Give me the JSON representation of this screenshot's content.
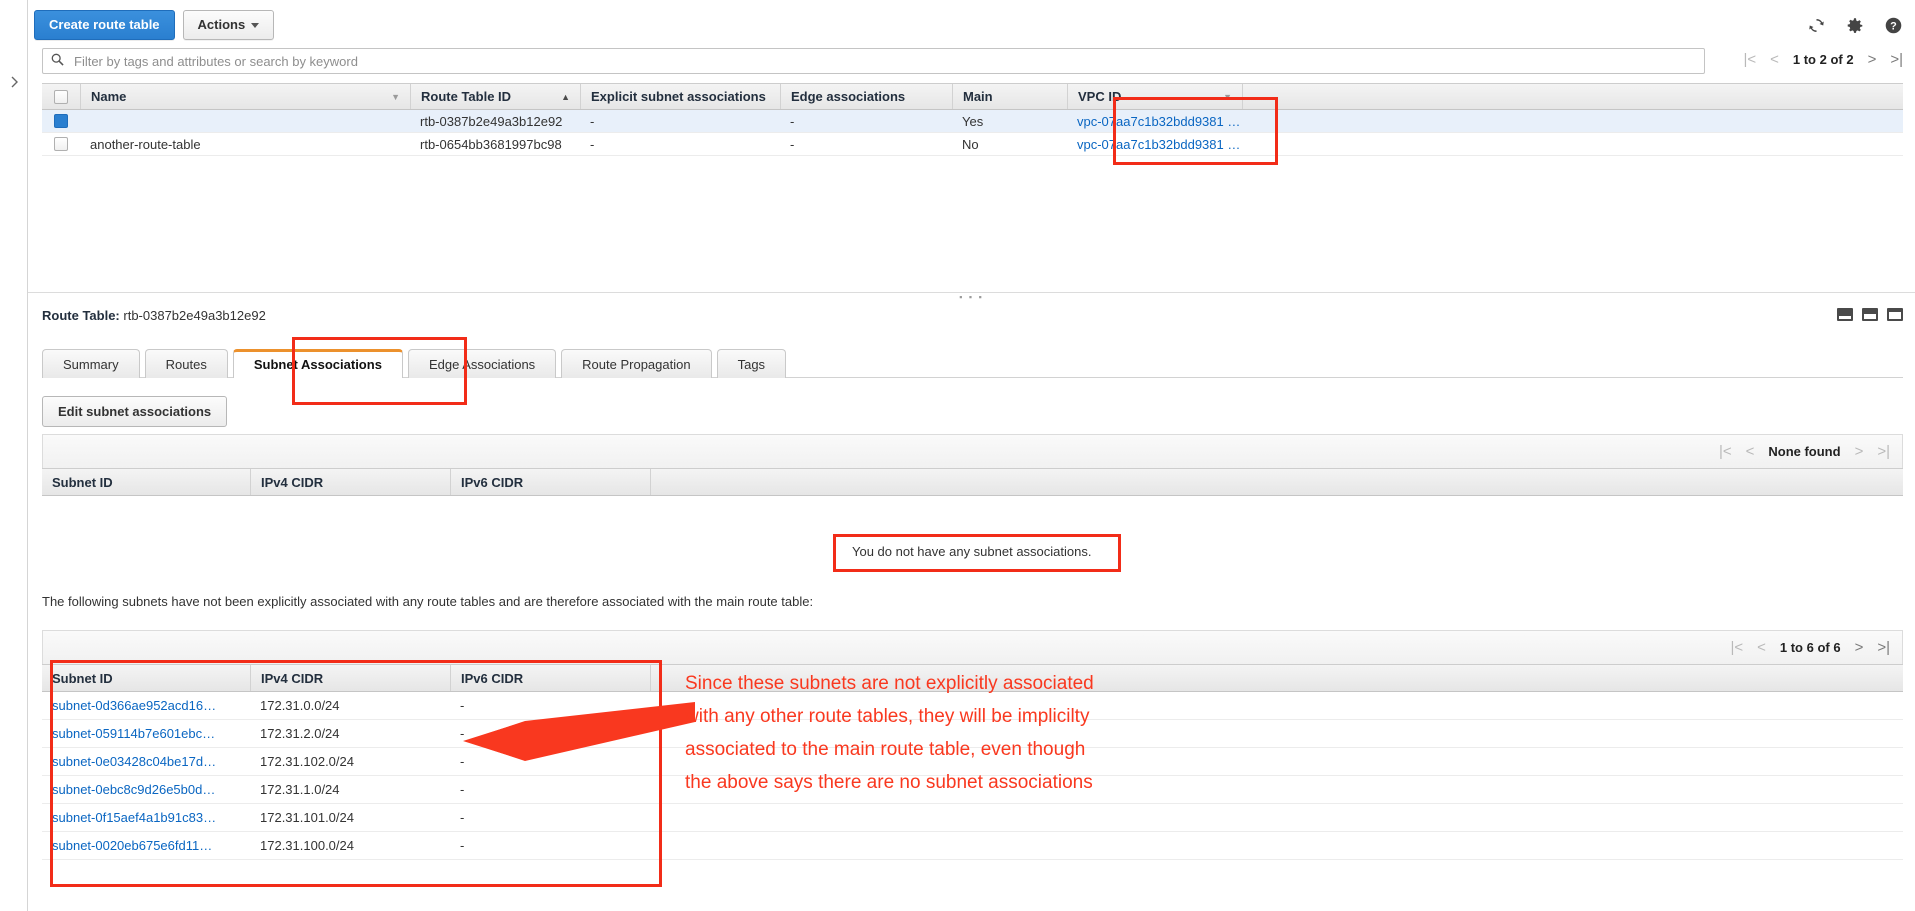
{
  "toolbar": {
    "create_label": "Create route table",
    "actions_label": "Actions",
    "refresh_icon": "refresh-icon",
    "settings_icon": "gear-icon",
    "help_icon": "help-icon"
  },
  "search": {
    "placeholder": "Filter by tags and attributes or search by keyword",
    "icon": "search-icon"
  },
  "top_pager": {
    "label": "1 to 2 of 2",
    "first": "|<",
    "prev": "<",
    "next": ">",
    "last": ">|"
  },
  "route_table_grid": {
    "columns": [
      "Name",
      "Route Table ID",
      "Explicit subnet associations",
      "Edge associations",
      "Main",
      "VPC ID"
    ],
    "rows": [
      {
        "selected": true,
        "name": "",
        "route_table_id": "rtb-0387b2e49a3b12e92",
        "explicit_subnet_associations": "-",
        "edge_associations": "-",
        "main": "Yes",
        "vpc_id": "vpc-07aa7c1b32bdd9381 …"
      },
      {
        "selected": false,
        "name": "another-route-table",
        "route_table_id": "rtb-0654bb3681997bc98",
        "explicit_subnet_associations": "-",
        "edge_associations": "-",
        "main": "No",
        "vpc_id": "vpc-07aa7c1b32bdd9381 …"
      }
    ]
  },
  "detail": {
    "title_label": "Route Table:",
    "title_value": "rtb-0387b2e49a3b12e92",
    "tabs": [
      {
        "label": "Summary",
        "active": false
      },
      {
        "label": "Routes",
        "active": false
      },
      {
        "label": "Subnet Associations",
        "active": true
      },
      {
        "label": "Edge Associations",
        "active": false
      },
      {
        "label": "Route Propagation",
        "active": false
      },
      {
        "label": "Tags",
        "active": false
      }
    ],
    "edit_button": "Edit subnet associations"
  },
  "associations_table": {
    "pager": {
      "label": "None found",
      "first": "|<",
      "prev": "<",
      "next": ">",
      "last": ">|"
    },
    "columns": [
      "Subnet ID",
      "IPv4 CIDR",
      "IPv6 CIDR"
    ],
    "rows": [],
    "empty_message": "You do not have any subnet associations."
  },
  "implicit_section": {
    "note": "The following subnets have not been explicitly associated with any route tables and are therefore associated with the main route table:",
    "pager": {
      "label": "1 to 6 of 6",
      "first": "|<",
      "prev": "<",
      "next": ">",
      "last": ">|"
    },
    "columns": [
      "Subnet ID",
      "IPv4 CIDR",
      "IPv6 CIDR"
    ],
    "rows": [
      {
        "subnet_id": "subnet-0d366ae952acd16…",
        "ipv4": "172.31.0.0/24",
        "ipv6": "-"
      },
      {
        "subnet_id": "subnet-059114b7e601ebc…",
        "ipv4": "172.31.2.0/24",
        "ipv6": "-"
      },
      {
        "subnet_id": "subnet-0e03428c04be17d…",
        "ipv4": "172.31.102.0/24",
        "ipv6": "-"
      },
      {
        "subnet_id": "subnet-0ebc8c9d26e5b0d…",
        "ipv4": "172.31.1.0/24",
        "ipv6": "-"
      },
      {
        "subnet_id": "subnet-0f15aef4a1b91c83…",
        "ipv4": "172.31.101.0/24",
        "ipv6": "-"
      },
      {
        "subnet_id": "subnet-0020eb675e6fd11…",
        "ipv4": "172.31.100.0/24",
        "ipv6": "-"
      }
    ]
  },
  "annotation": {
    "color": "#f9381f",
    "lines": [
      "Since these subnets are not explicitly associated",
      "with any other route tables, they will be implicilty",
      "associated to the main route table, even though",
      "the above says there are no subnet associations"
    ]
  },
  "view_icons": [
    "view-compact-icon",
    "view-split-icon",
    "view-expanded-icon"
  ]
}
